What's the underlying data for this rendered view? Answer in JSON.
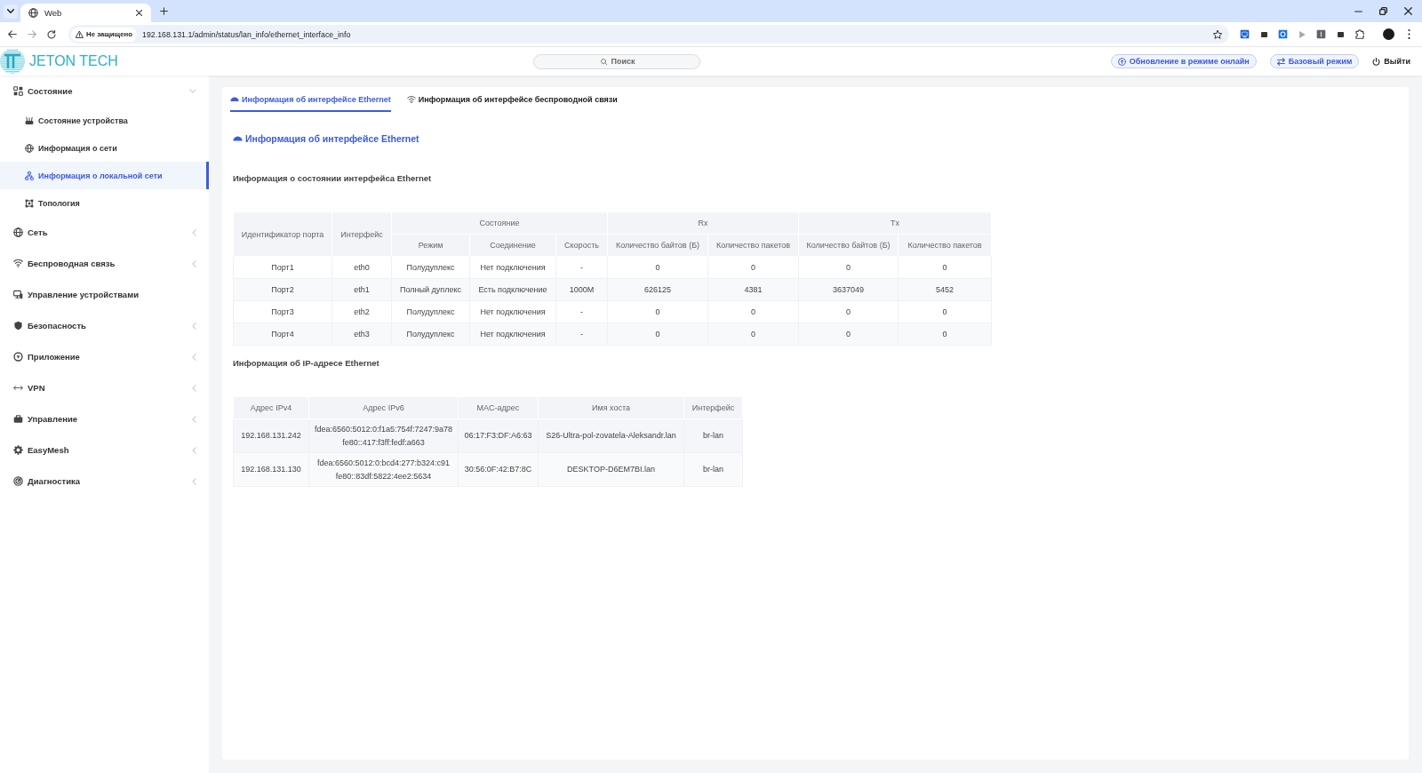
{
  "browser": {
    "tab_title": "Web",
    "security_label": "Не защищено",
    "url": "192.168.131.1/admin/status/lan_info/ethernet_interface_info"
  },
  "header": {
    "logo": "JETON TECH",
    "search": {
      "placeholder": "Поиск"
    },
    "actions": [
      {
        "label": "Обновление в режиме онлайн",
        "kind": "pill"
      },
      {
        "label": "Базовый режим",
        "kind": "pill"
      },
      {
        "label": "Выйти",
        "kind": "plain"
      }
    ]
  },
  "sidebar": {
    "items": [
      {
        "label": "Состояние",
        "kind": "group",
        "expanded": true,
        "children": [
          {
            "label": "Состояние устройства",
            "selected": false
          },
          {
            "label": "Информация о сети",
            "selected": false
          },
          {
            "label": "Информация о локальной сети",
            "selected": true
          },
          {
            "label": "Топология",
            "selected": false
          }
        ]
      },
      {
        "label": "Сеть",
        "kind": "group",
        "expanded": false
      },
      {
        "label": "Беспроводная связь",
        "kind": "group",
        "expanded": false
      },
      {
        "label": "Управление устройствами",
        "kind": "link",
        "selected": false
      },
      {
        "label": "Безопасность",
        "kind": "group",
        "expanded": false
      },
      {
        "label": "Приложение",
        "kind": "group",
        "expanded": false
      },
      {
        "label": "VPN",
        "kind": "group",
        "expanded": false
      },
      {
        "label": "Управление",
        "kind": "group",
        "expanded": false
      },
      {
        "label": "EasyMesh",
        "kind": "group",
        "expanded": false
      },
      {
        "label": "Диагностика",
        "kind": "group",
        "expanded": false
      }
    ]
  },
  "content": {
    "tabs": [
      {
        "label": "Информация об интерфейсе Ethernet",
        "selected": true
      },
      {
        "label": "Информация об интерфейсе беспроводной связи",
        "selected": false
      }
    ],
    "title": "Информация об интерфейсе Ethernet",
    "sections": [
      {
        "title": "Информация о состоянии интерфейса Ethernet",
        "table": {
          "header_rows": [
            [
              {
                "label": "Идентификатор порта",
                "rowspan": 2
              },
              {
                "label": "Интерфейс",
                "rowspan": 2
              },
              {
                "label": "Состояние",
                "colspan": 3
              },
              {
                "label": "Rx",
                "colspan": 2
              },
              {
                "label": "Tx",
                "colspan": 2
              }
            ],
            [
              {
                "label": "Режим"
              },
              {
                "label": "Соединение"
              },
              {
                "label": "Скорость"
              },
              {
                "label": "Количество байтов (Б)"
              },
              {
                "label": "Количество пакетов"
              },
              {
                "label": "Количество байтов (Б)"
              },
              {
                "label": "Количество пакетов"
              }
            ]
          ],
          "rows": [
            [
              "Порт1",
              "eth0",
              "Полудуплекс",
              "Нет подключения",
              "-",
              "0",
              "0",
              "0",
              "0"
            ],
            [
              "Порт2",
              "eth1",
              "Полный дуплекс",
              "Есть подключение",
              "1000M",
              "626125",
              "4381",
              "3637049",
              "5452"
            ],
            [
              "Порт3",
              "eth2",
              "Полудуплекс",
              "Нет подключения",
              "-",
              "0",
              "0",
              "0",
              "0"
            ],
            [
              "Порт4",
              "eth3",
              "Полудуплекс",
              "Нет подключения",
              "-",
              "0",
              "0",
              "0",
              "0"
            ]
          ]
        }
      },
      {
        "title": "Информация об IP-адресе Ethernet",
        "table": {
          "header_rows": [
            [
              {
                "label": "Адрес IPv4"
              },
              {
                "label": "Адрес IPv6"
              },
              {
                "label": "MAC-адрес"
              },
              {
                "label": "Имя хоста"
              },
              {
                "label": "Интерфейс"
              }
            ]
          ],
          "rows": [
            [
              "192.168.131.242",
              [
                "fdea:6560:5012:0:f1a5:754f:7247:9a78",
                "fe80::417:f3ff:fedf:a663"
              ],
              "06:17:F3:DF:A6:63",
              "S26-Ultra-pol-zovatela-Aleksandr.lan",
              "br-lan"
            ],
            [
              "192.168.131.130",
              [
                "fdea:6560:5012:0:bcd4:277:b324:c91",
                "fe80::83df:5822:4ee2:5634"
              ],
              "30:56:0F:42:B7:8C",
              "DESKTOP-D6EM7BI.lan",
              "br-lan"
            ]
          ]
        }
      }
    ]
  }
}
